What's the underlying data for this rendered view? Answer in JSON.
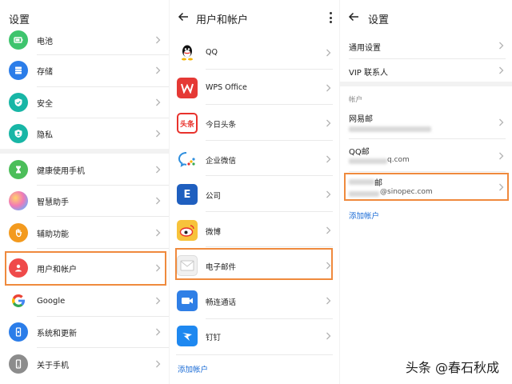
{
  "panel1": {
    "title": "设置",
    "items": [
      {
        "label": "电池",
        "icon": "battery-icon",
        "color": "#3ec46d"
      },
      {
        "label": "存储",
        "icon": "storage-icon",
        "color": "#2b7de9"
      },
      {
        "label": "安全",
        "icon": "shield-icon",
        "color": "#18b6a6"
      },
      {
        "label": "隐私",
        "icon": "privacy-icon",
        "color": "#18b6a6"
      },
      {
        "label": "健康使用手机",
        "icon": "hourglass-icon",
        "color": "#4cbe5a"
      },
      {
        "label": "智慧助手",
        "icon": "assistant-icon",
        "color": "#a58df0"
      },
      {
        "label": "辅助功能",
        "icon": "hand-icon",
        "color": "#f39a1e"
      },
      {
        "label": "用户和帐户",
        "icon": "user-icon",
        "color": "#ef4a4a"
      },
      {
        "label": "Google",
        "icon": "google-icon",
        "color": "#4285f4"
      },
      {
        "label": "系统和更新",
        "icon": "phone-icon",
        "color": "#2b7de9"
      },
      {
        "label": "关于手机",
        "icon": "phone-info-icon",
        "color": "#8c8c8c"
      }
    ]
  },
  "panel2": {
    "title": "用户和帐户",
    "items": [
      {
        "label": "QQ",
        "icon": "qq-icon"
      },
      {
        "label": "WPS Office",
        "icon": "wps-icon"
      },
      {
        "label": "今日头条",
        "icon": "toutiao-icon",
        "badge": "头条"
      },
      {
        "label": "企业微信",
        "icon": "wework-icon"
      },
      {
        "label": "公司",
        "icon": "exchange-icon",
        "badge": "E"
      },
      {
        "label": "微博",
        "icon": "weibo-icon"
      },
      {
        "label": "电子邮件",
        "icon": "mail-icon"
      },
      {
        "label": "畅连通话",
        "icon": "video-call-icon"
      },
      {
        "label": "钉钉",
        "icon": "dingtalk-icon"
      }
    ],
    "add_account": "添加帐户"
  },
  "panel3": {
    "title": "设置",
    "items": [
      {
        "label": "通用设置"
      },
      {
        "label": "VIP 联系人"
      }
    ],
    "section": "帐户",
    "accounts": [
      {
        "name": "网易邮",
        "address": ""
      },
      {
        "name": "QQ邮",
        "address": "q.com"
      },
      {
        "name": "邮",
        "address": "@sinopec.com"
      }
    ],
    "add_account": "添加帐户"
  },
  "watermark": "头条 @春石秋成",
  "colors": {
    "highlight": "#ef8a3d",
    "link": "#1a6bd6"
  }
}
